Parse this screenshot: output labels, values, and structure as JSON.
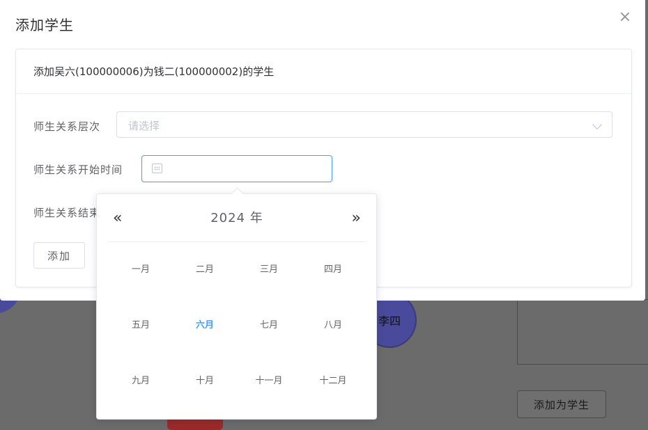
{
  "dialog": {
    "title": "添加学生",
    "close_glyph": "×",
    "card_header": "添加吴六(100000006)为钱二(100000002)的学生",
    "form": {
      "level_label": "师生关系层次",
      "level_placeholder": "请选择",
      "start_label": "师生关系开始时间",
      "end_label": "师生关系结束时间",
      "start_value": ""
    },
    "add_button": "添加"
  },
  "month_picker": {
    "prev_glyph": "«",
    "next_glyph": "»",
    "year": "2024 年",
    "months": [
      "一月",
      "二月",
      "三月",
      "四月",
      "五月",
      "六月",
      "七月",
      "八月",
      "九月",
      "十月",
      "十一月",
      "十二月"
    ],
    "current_month_index": 5,
    "accent_color": "#409eff"
  },
  "background": {
    "node_label": "李四",
    "button_label": "添加为学生"
  },
  "icons": {
    "calendar": "calendar-icon",
    "chevron": "chevron-down-icon",
    "close": "close-icon"
  }
}
